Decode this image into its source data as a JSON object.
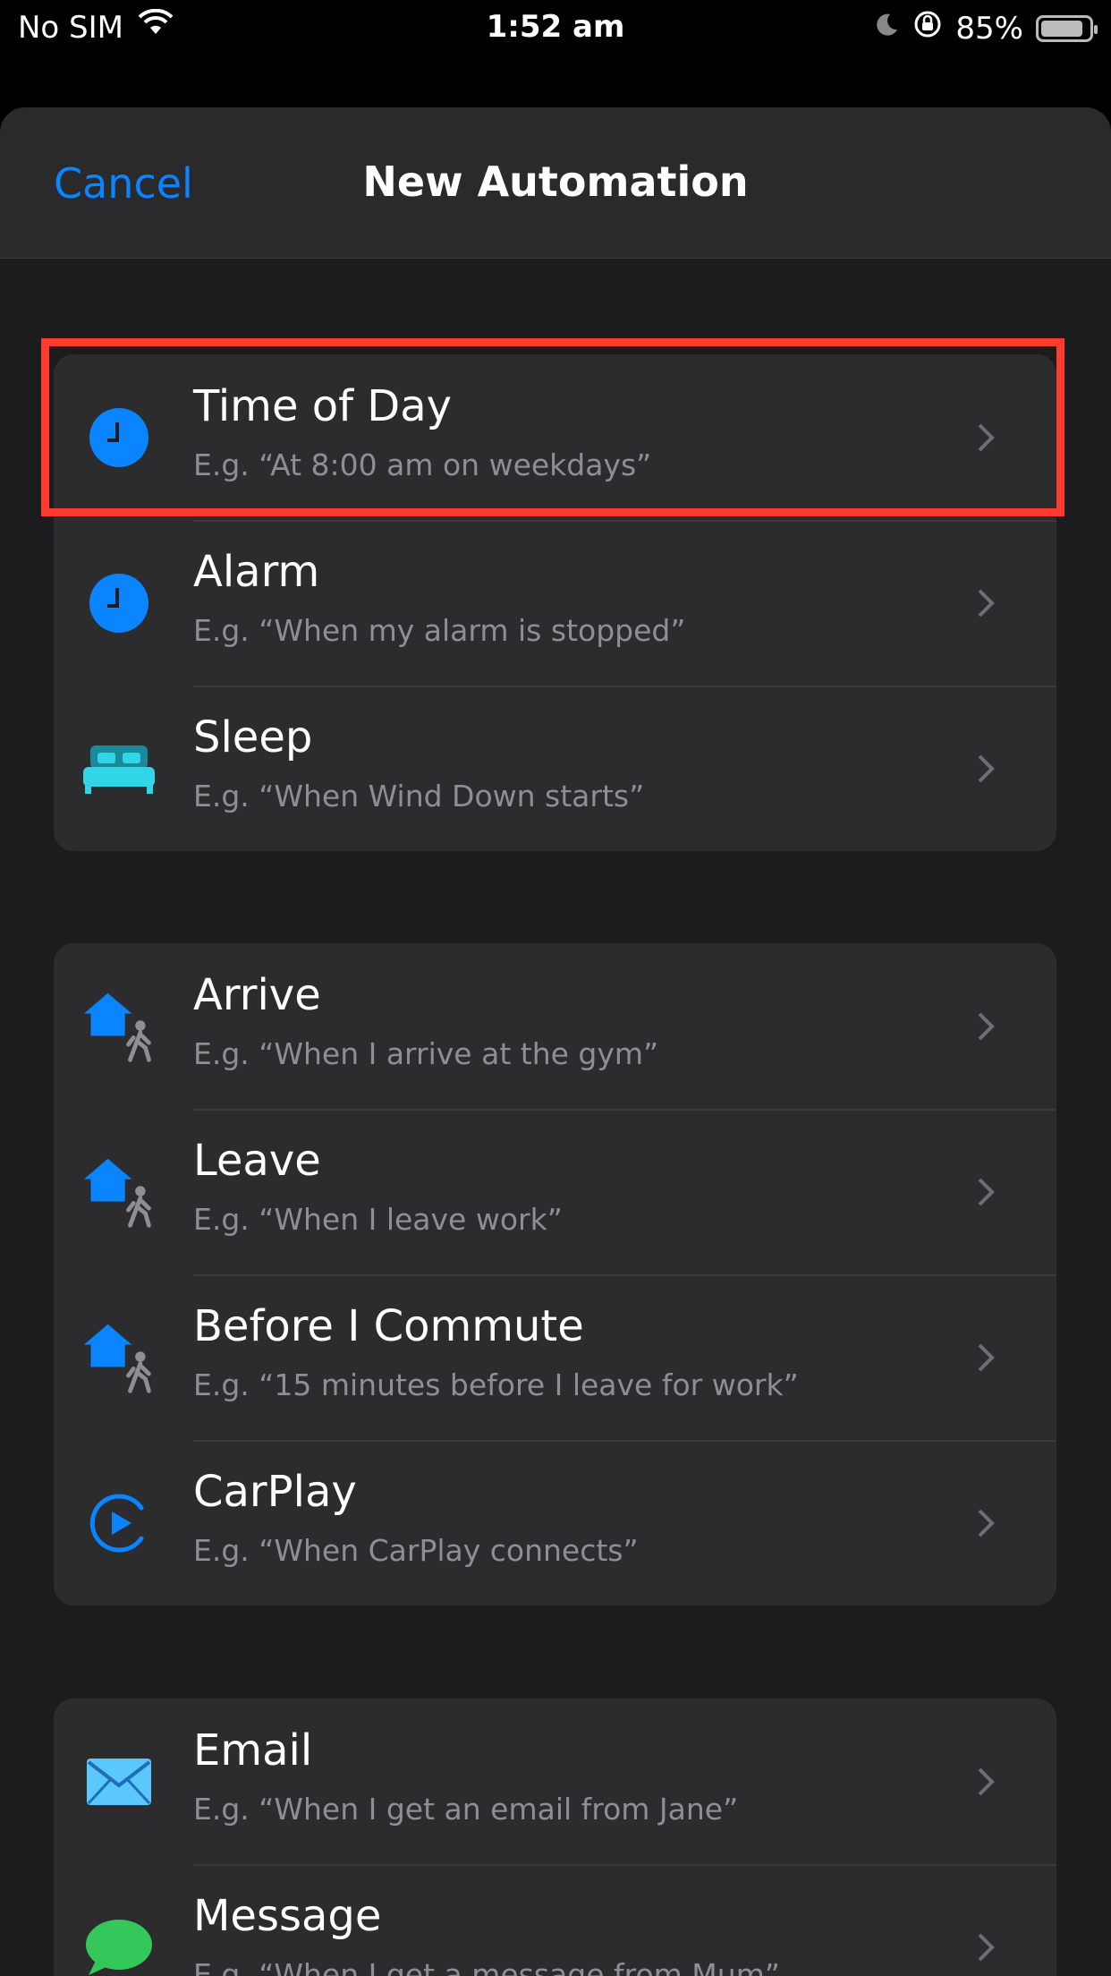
{
  "status": {
    "carrier": "No SIM",
    "time": "1:52 am",
    "battery": "85%"
  },
  "nav": {
    "cancel_label": "Cancel",
    "title": "New Automation"
  },
  "colors": {
    "accent": "#0a84ff",
    "highlight": "#ff3b30",
    "sleep": "#30d5e8",
    "message": "#34c759"
  },
  "groups": [
    {
      "items": [
        {
          "title": "Time of Day",
          "subtitle": "E.g. “At 8:00 am on weekdays”",
          "icon": "clock-icon"
        },
        {
          "title": "Alarm",
          "subtitle": "E.g. “When my alarm is stopped”",
          "icon": "clock-icon"
        },
        {
          "title": "Sleep",
          "subtitle": "E.g. “When Wind Down starts”",
          "icon": "bed-icon"
        }
      ]
    },
    {
      "items": [
        {
          "title": "Arrive",
          "subtitle": "E.g. “When I arrive at the gym”",
          "icon": "home-person-icon"
        },
        {
          "title": "Leave",
          "subtitle": "E.g. “When I leave work”",
          "icon": "home-person-icon"
        },
        {
          "title": "Before I Commute",
          "subtitle": "E.g. “15 minutes before I leave for work”",
          "icon": "home-person-icon"
        },
        {
          "title": "CarPlay",
          "subtitle": "E.g. “When CarPlay connects”",
          "icon": "carplay-icon"
        }
      ]
    },
    {
      "items": [
        {
          "title": "Email",
          "subtitle": "E.g. “When I get an email from Jane”",
          "icon": "envelope-icon"
        },
        {
          "title": "Message",
          "subtitle": "E.g. “When I get a message from Mum”",
          "icon": "message-icon"
        }
      ]
    }
  ]
}
